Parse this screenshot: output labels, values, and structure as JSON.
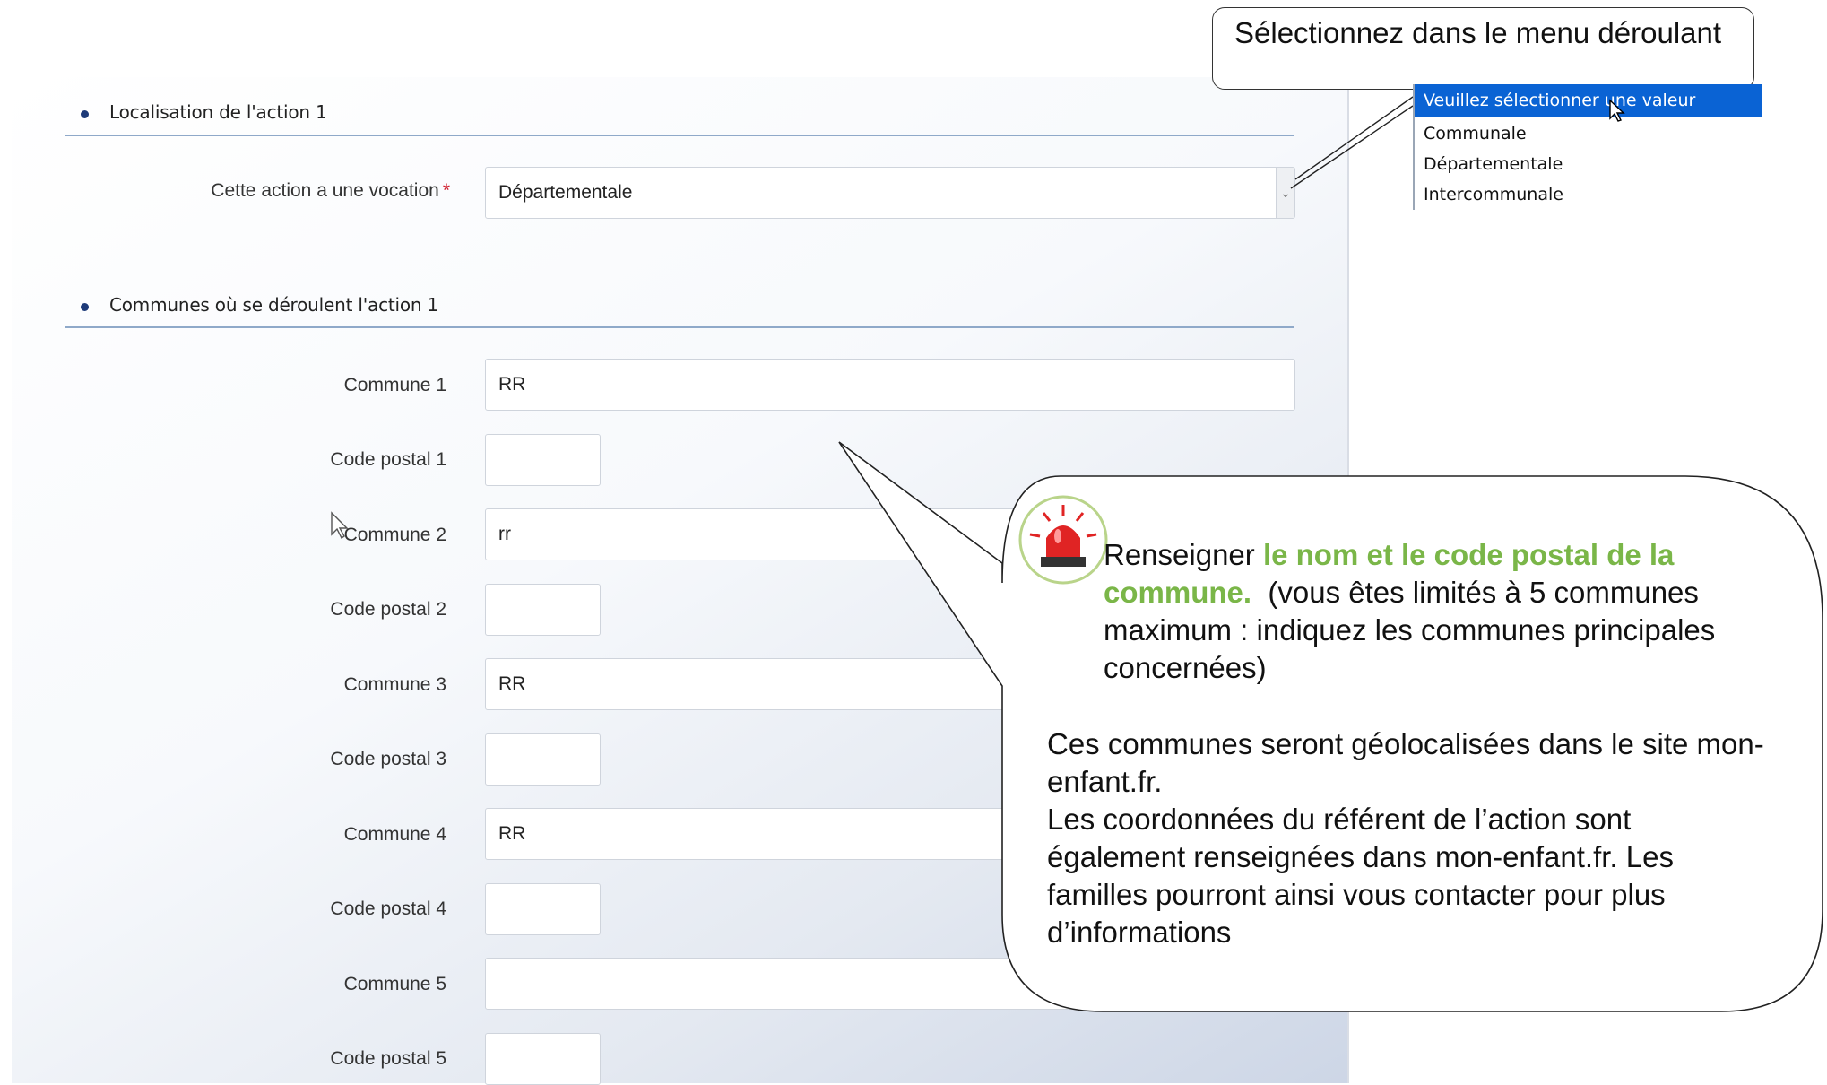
{
  "form": {
    "section1_title": "Localisation de l'action 1",
    "vocation_label": "Cette action a une vocation",
    "vocation_required_mark": "*",
    "vocation_value": "Départementale",
    "section2_title": "Communes où se déroulent l'action 1",
    "fields": [
      {
        "commune_label": "Commune 1",
        "commune_value": "RR",
        "postal_label": "Code postal 1",
        "postal_value": ""
      },
      {
        "commune_label": "Commune 2",
        "commune_value": "rr",
        "postal_label": "Code postal 2",
        "postal_value": ""
      },
      {
        "commune_label": "Commune 3",
        "commune_value": "RR",
        "postal_label": "Code postal 3",
        "postal_value": ""
      },
      {
        "commune_label": "Commune 4",
        "commune_value": "RR",
        "postal_label": "Code postal 4",
        "postal_value": ""
      },
      {
        "commune_label": "Commune 5",
        "commune_value": "",
        "postal_label": "Code postal 5",
        "postal_value": ""
      }
    ]
  },
  "dropdown": {
    "options": [
      "Veuillez sélectionner une valeur",
      "Communale",
      "Départementale",
      "Intercommunale"
    ],
    "highlight_color": "#0a63d4"
  },
  "callouts": {
    "top": "Sélectionnez dans le menu déroulant",
    "big_part1": "Renseigner ",
    "big_highlight": "le nom et le code postal de la commune.",
    "big_part2": "(vous êtes limités à 5 communes maximum : indiquez les communes principales concernées)",
    "big_para2": "Ces communes seront géolocalisées dans le site mon-enfant.fr.",
    "big_para3": "Les coordonnées du référent de l’action sont également renseignées dans mon-enfant.fr. Les familles pourront ainsi vous contacter pour plus d’informations",
    "highlight_color": "#7ab648"
  },
  "icons": [
    "alarm-siren-icon",
    "mouse-pointer-icon",
    "chevron-down-icon"
  ]
}
